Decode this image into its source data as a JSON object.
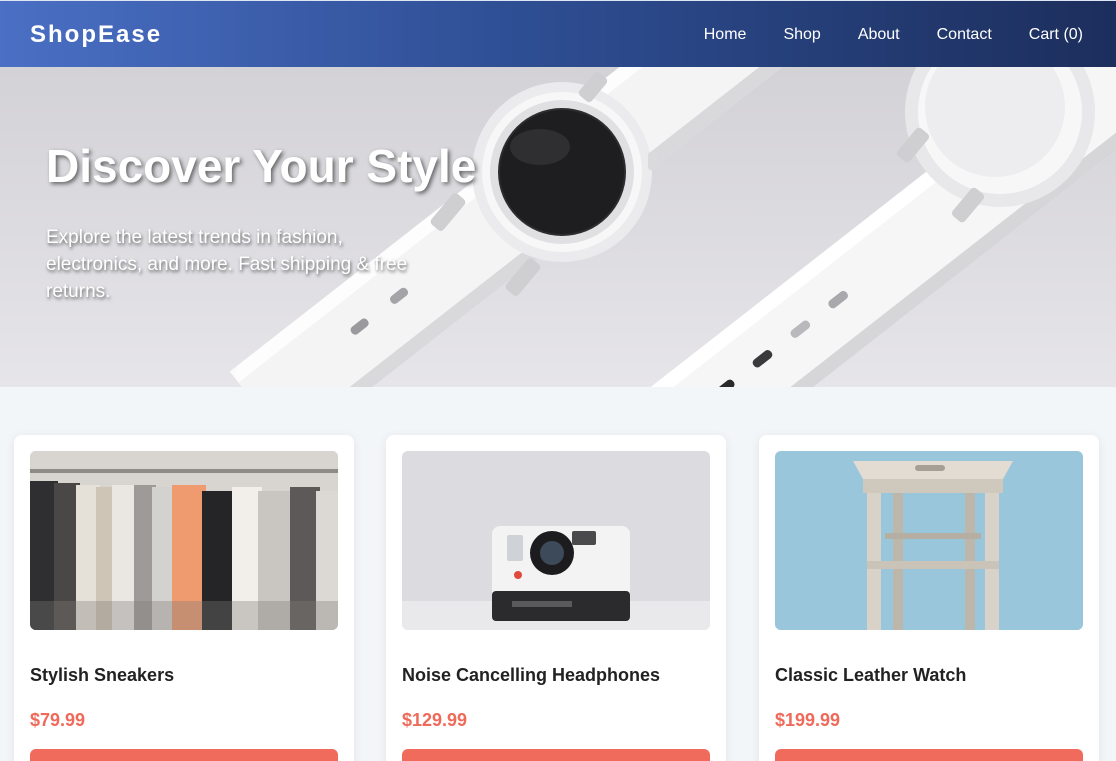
{
  "header": {
    "brand": "ShopEase",
    "nav": [
      {
        "label": "Home"
      },
      {
        "label": "Shop"
      },
      {
        "label": "About"
      },
      {
        "label": "Contact"
      },
      {
        "label": "Cart (0)"
      }
    ]
  },
  "hero": {
    "title": "Discover Your Style",
    "subtitle": "Explore the latest trends in fashion, electronics, and more. Fast shipping & free returns."
  },
  "products": [
    {
      "name": "Stylish Sneakers",
      "price": "$79.99",
      "image_icon": "clothing-rack-image"
    },
    {
      "name": "Noise Cancelling Headphones",
      "price": "$129.99",
      "image_icon": "instant-camera-image"
    },
    {
      "name": "Classic Leather Watch",
      "price": "$199.99",
      "image_icon": "wooden-stool-image"
    }
  ],
  "colors": {
    "nav_start": "#4a6fc4",
    "nav_end": "#1c2e5c",
    "accent": "#f06b5b",
    "price": "#ef6a5a",
    "background": "#f3f6f9"
  }
}
